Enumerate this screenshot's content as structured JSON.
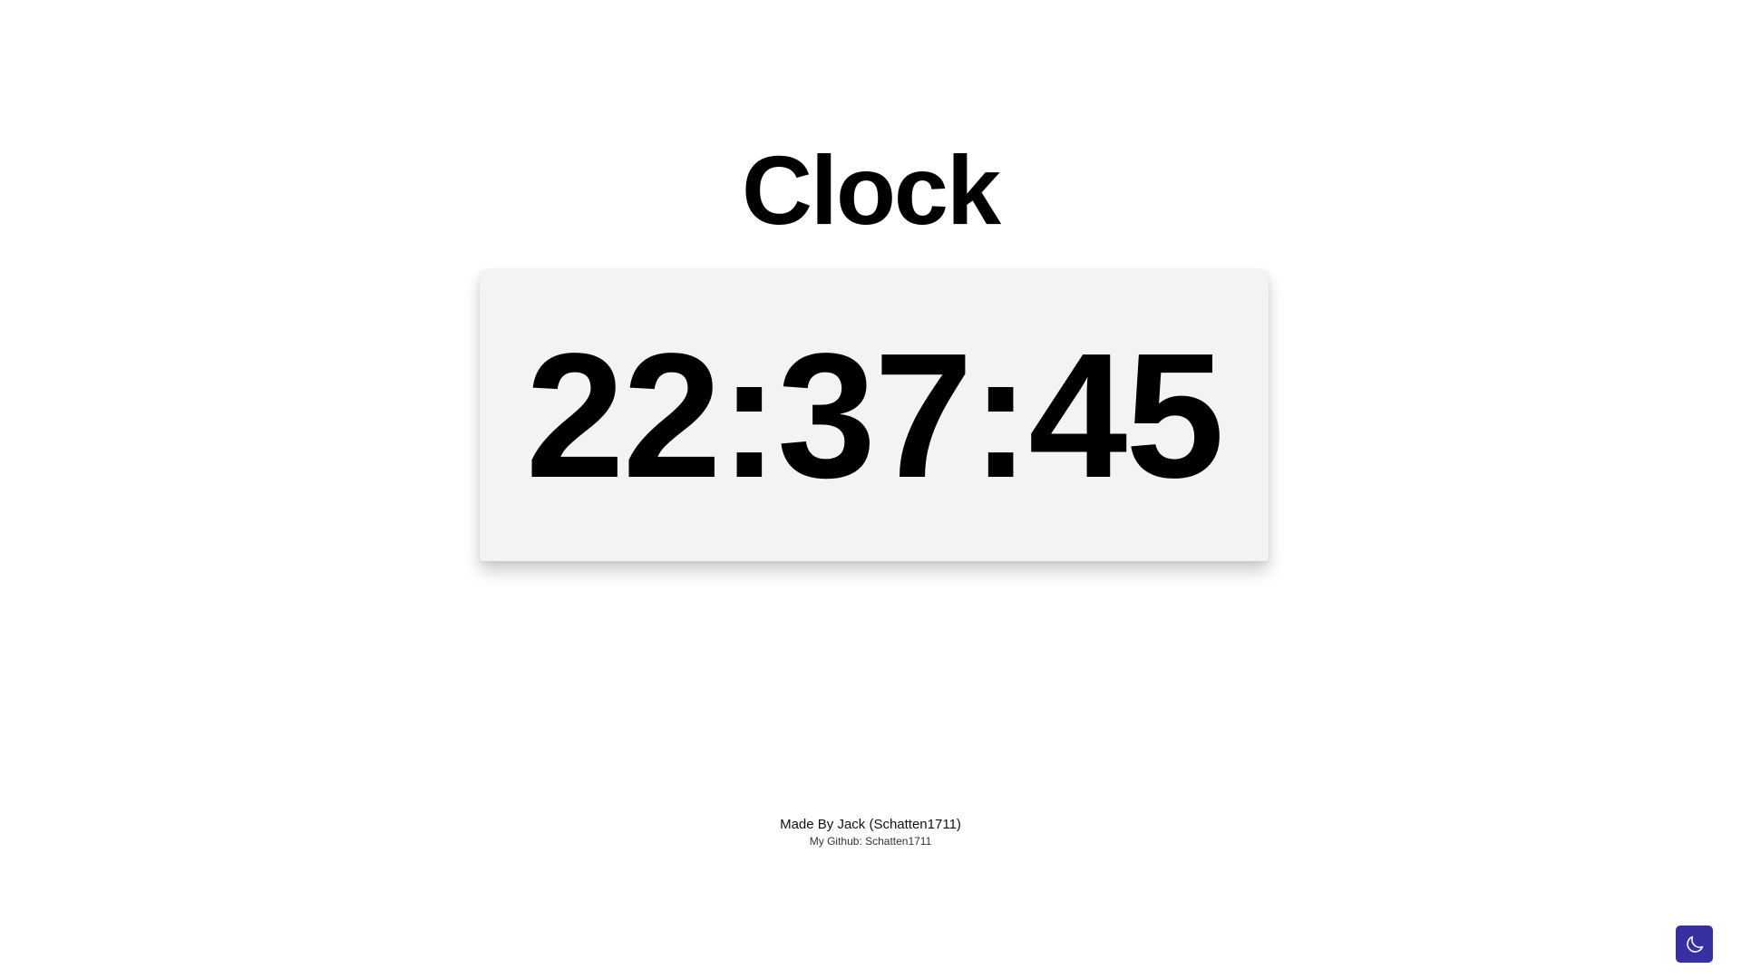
{
  "page": {
    "title": "Clock"
  },
  "clock": {
    "time": "22:37:45"
  },
  "footer": {
    "made_by": "Made By Jack (Schatten1711)",
    "github": "My Github: Schatten1711"
  },
  "theme_toggle": {
    "icon": "moon-icon",
    "background": "#3730a3",
    "icon_color": "#ffffff"
  },
  "colors": {
    "card_background": "#f2f3f5",
    "page_background": "#ffffff",
    "text": "#000000"
  }
}
